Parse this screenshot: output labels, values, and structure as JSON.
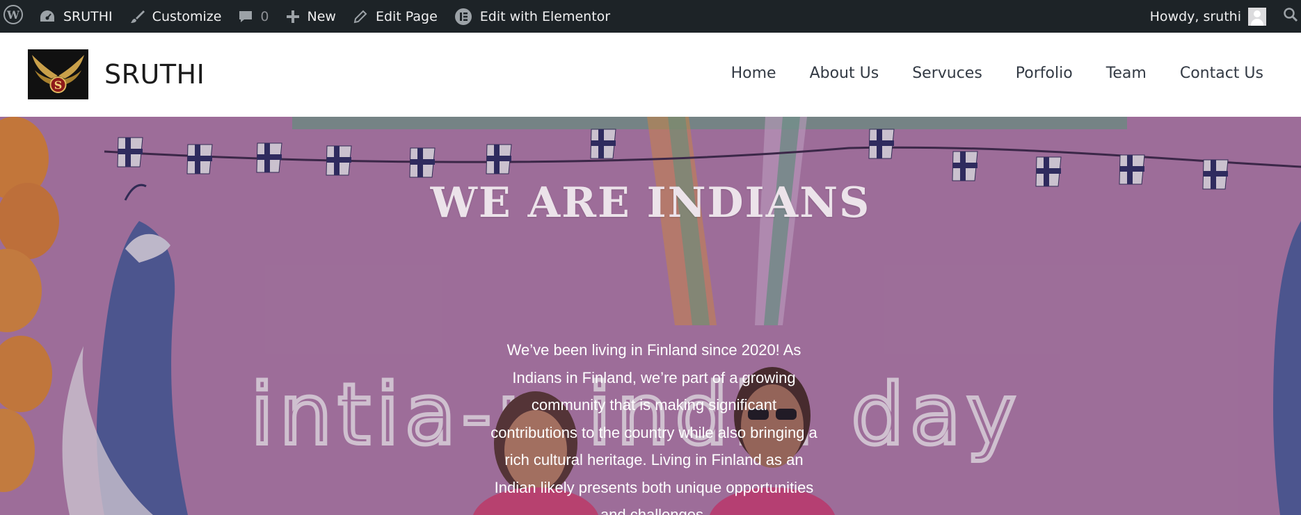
{
  "admin_bar": {
    "site_name": "SRUTHI",
    "customize": "Customize",
    "comments_count": "0",
    "new": "New",
    "edit_page": "Edit Page",
    "edit_elementor": "Edit with Elementor",
    "howdy": "Howdy, sruthi"
  },
  "header": {
    "site_title": "SRUTHI",
    "logo_letter": "S",
    "nav": [
      "Home",
      "About Us",
      "Servuces",
      "Porfolio",
      "Team",
      "Contact Us"
    ]
  },
  "hero": {
    "title": "WE ARE INDIANS",
    "text": "We’ve been living in Finland since 2020! As Indians in Finland, we’re part of a growing community that is making significant contributions to the country while also bringing a rich cultural heritage. Living in Finland as an Indian likely presents both unique opportunities and challenges.",
    "banner_text": "intia-p   india day"
  },
  "colors": {
    "admin_bar_bg": "#1d2327",
    "hero_bg": "#b781b0",
    "nav_text": "#333a44"
  }
}
